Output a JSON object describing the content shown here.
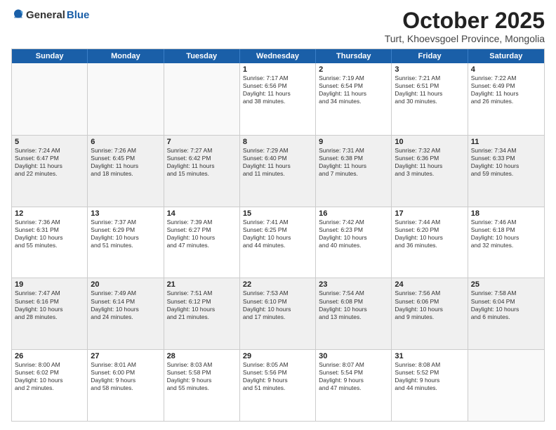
{
  "logo": {
    "general": "General",
    "blue": "Blue"
  },
  "title": "October 2025",
  "subtitle": "Turt, Khoevsgoel Province, Mongolia",
  "days": [
    "Sunday",
    "Monday",
    "Tuesday",
    "Wednesday",
    "Thursday",
    "Friday",
    "Saturday"
  ],
  "rows": [
    [
      {
        "num": "",
        "lines": [],
        "empty": true
      },
      {
        "num": "",
        "lines": [],
        "empty": true
      },
      {
        "num": "",
        "lines": [],
        "empty": true
      },
      {
        "num": "1",
        "lines": [
          "Sunrise: 7:17 AM",
          "Sunset: 6:56 PM",
          "Daylight: 11 hours",
          "and 38 minutes."
        ]
      },
      {
        "num": "2",
        "lines": [
          "Sunrise: 7:19 AM",
          "Sunset: 6:54 PM",
          "Daylight: 11 hours",
          "and 34 minutes."
        ]
      },
      {
        "num": "3",
        "lines": [
          "Sunrise: 7:21 AM",
          "Sunset: 6:51 PM",
          "Daylight: 11 hours",
          "and 30 minutes."
        ]
      },
      {
        "num": "4",
        "lines": [
          "Sunrise: 7:22 AM",
          "Sunset: 6:49 PM",
          "Daylight: 11 hours",
          "and 26 minutes."
        ]
      }
    ],
    [
      {
        "num": "5",
        "lines": [
          "Sunrise: 7:24 AM",
          "Sunset: 6:47 PM",
          "Daylight: 11 hours",
          "and 22 minutes."
        ]
      },
      {
        "num": "6",
        "lines": [
          "Sunrise: 7:26 AM",
          "Sunset: 6:45 PM",
          "Daylight: 11 hours",
          "and 18 minutes."
        ]
      },
      {
        "num": "7",
        "lines": [
          "Sunrise: 7:27 AM",
          "Sunset: 6:42 PM",
          "Daylight: 11 hours",
          "and 15 minutes."
        ]
      },
      {
        "num": "8",
        "lines": [
          "Sunrise: 7:29 AM",
          "Sunset: 6:40 PM",
          "Daylight: 11 hours",
          "and 11 minutes."
        ]
      },
      {
        "num": "9",
        "lines": [
          "Sunrise: 7:31 AM",
          "Sunset: 6:38 PM",
          "Daylight: 11 hours",
          "and 7 minutes."
        ]
      },
      {
        "num": "10",
        "lines": [
          "Sunrise: 7:32 AM",
          "Sunset: 6:36 PM",
          "Daylight: 11 hours",
          "and 3 minutes."
        ]
      },
      {
        "num": "11",
        "lines": [
          "Sunrise: 7:34 AM",
          "Sunset: 6:33 PM",
          "Daylight: 10 hours",
          "and 59 minutes."
        ]
      }
    ],
    [
      {
        "num": "12",
        "lines": [
          "Sunrise: 7:36 AM",
          "Sunset: 6:31 PM",
          "Daylight: 10 hours",
          "and 55 minutes."
        ]
      },
      {
        "num": "13",
        "lines": [
          "Sunrise: 7:37 AM",
          "Sunset: 6:29 PM",
          "Daylight: 10 hours",
          "and 51 minutes."
        ]
      },
      {
        "num": "14",
        "lines": [
          "Sunrise: 7:39 AM",
          "Sunset: 6:27 PM",
          "Daylight: 10 hours",
          "and 47 minutes."
        ]
      },
      {
        "num": "15",
        "lines": [
          "Sunrise: 7:41 AM",
          "Sunset: 6:25 PM",
          "Daylight: 10 hours",
          "and 44 minutes."
        ]
      },
      {
        "num": "16",
        "lines": [
          "Sunrise: 7:42 AM",
          "Sunset: 6:23 PM",
          "Daylight: 10 hours",
          "and 40 minutes."
        ]
      },
      {
        "num": "17",
        "lines": [
          "Sunrise: 7:44 AM",
          "Sunset: 6:20 PM",
          "Daylight: 10 hours",
          "and 36 minutes."
        ]
      },
      {
        "num": "18",
        "lines": [
          "Sunrise: 7:46 AM",
          "Sunset: 6:18 PM",
          "Daylight: 10 hours",
          "and 32 minutes."
        ]
      }
    ],
    [
      {
        "num": "19",
        "lines": [
          "Sunrise: 7:47 AM",
          "Sunset: 6:16 PM",
          "Daylight: 10 hours",
          "and 28 minutes."
        ]
      },
      {
        "num": "20",
        "lines": [
          "Sunrise: 7:49 AM",
          "Sunset: 6:14 PM",
          "Daylight: 10 hours",
          "and 24 minutes."
        ]
      },
      {
        "num": "21",
        "lines": [
          "Sunrise: 7:51 AM",
          "Sunset: 6:12 PM",
          "Daylight: 10 hours",
          "and 21 minutes."
        ]
      },
      {
        "num": "22",
        "lines": [
          "Sunrise: 7:53 AM",
          "Sunset: 6:10 PM",
          "Daylight: 10 hours",
          "and 17 minutes."
        ]
      },
      {
        "num": "23",
        "lines": [
          "Sunrise: 7:54 AM",
          "Sunset: 6:08 PM",
          "Daylight: 10 hours",
          "and 13 minutes."
        ]
      },
      {
        "num": "24",
        "lines": [
          "Sunrise: 7:56 AM",
          "Sunset: 6:06 PM",
          "Daylight: 10 hours",
          "and 9 minutes."
        ]
      },
      {
        "num": "25",
        "lines": [
          "Sunrise: 7:58 AM",
          "Sunset: 6:04 PM",
          "Daylight: 10 hours",
          "and 6 minutes."
        ]
      }
    ],
    [
      {
        "num": "26",
        "lines": [
          "Sunrise: 8:00 AM",
          "Sunset: 6:02 PM",
          "Daylight: 10 hours",
          "and 2 minutes."
        ]
      },
      {
        "num": "27",
        "lines": [
          "Sunrise: 8:01 AM",
          "Sunset: 6:00 PM",
          "Daylight: 9 hours",
          "and 58 minutes."
        ]
      },
      {
        "num": "28",
        "lines": [
          "Sunrise: 8:03 AM",
          "Sunset: 5:58 PM",
          "Daylight: 9 hours",
          "and 55 minutes."
        ]
      },
      {
        "num": "29",
        "lines": [
          "Sunrise: 8:05 AM",
          "Sunset: 5:56 PM",
          "Daylight: 9 hours",
          "and 51 minutes."
        ]
      },
      {
        "num": "30",
        "lines": [
          "Sunrise: 8:07 AM",
          "Sunset: 5:54 PM",
          "Daylight: 9 hours",
          "and 47 minutes."
        ]
      },
      {
        "num": "31",
        "lines": [
          "Sunrise: 8:08 AM",
          "Sunset: 5:52 PM",
          "Daylight: 9 hours",
          "and 44 minutes."
        ]
      },
      {
        "num": "",
        "lines": [],
        "empty": true
      }
    ]
  ]
}
